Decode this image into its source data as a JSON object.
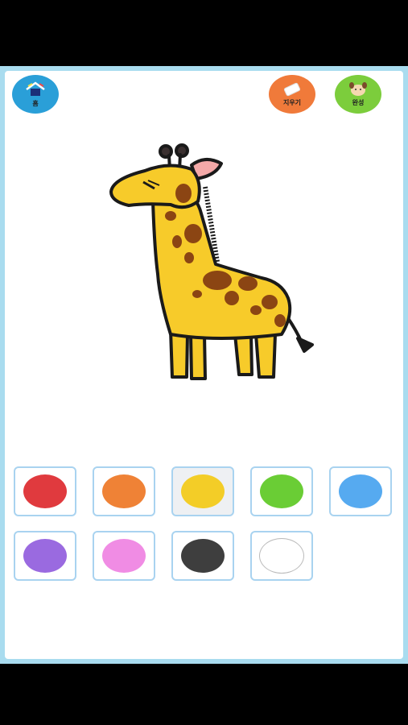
{
  "header": {
    "home_label": "홈",
    "erase_label": "지우기",
    "done_label": "완성"
  },
  "icons": {
    "home": "house-icon",
    "erase": "eraser-icon",
    "done": "pig-face-icon"
  },
  "drawing": {
    "subject": "giraffe",
    "body_color": "#f7cb2a",
    "spot_color": "#8b4513",
    "ear_color": "#f4a9a8"
  },
  "palette": {
    "selected_index": 2,
    "colors": [
      "#e03a3e",
      "#ef8236",
      "#f3cd27",
      "#6acd35",
      "#56aaf0",
      "#9a6ae0",
      "#f08ce4",
      "#3e3e3e",
      "#ffffff"
    ]
  }
}
